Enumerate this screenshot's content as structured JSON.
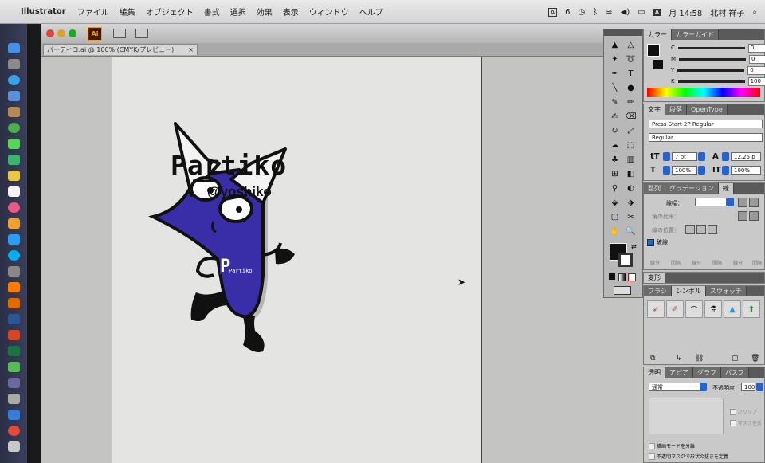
{
  "menubar": {
    "app_name": "Illustrator",
    "items": [
      "ファイル",
      "編集",
      "オブジェクト",
      "書式",
      "選択",
      "効果",
      "表示",
      "ウィンドウ",
      "ヘルプ"
    ],
    "status": {
      "input_indicator": "A",
      "badge": "6",
      "clock": "月 14:58",
      "user": "北村 祥子"
    }
  },
  "window": {
    "tab_title": "パーティコ.ai @ 100% (CMYK/プレビュー)",
    "tab_close": "×"
  },
  "artwork": {
    "title": "Partiko",
    "handle": "@yoshiko",
    "shirt_letters": "Partiko",
    "character_color": "#3a2ea8"
  },
  "color_panel": {
    "tabs": [
      "カラー",
      "カラーガイド"
    ],
    "channels": [
      {
        "label": "C",
        "value": "0"
      },
      {
        "label": "M",
        "value": "0"
      },
      {
        "label": "Y",
        "value": "0"
      },
      {
        "label": "K",
        "value": "100"
      }
    ]
  },
  "type_panel": {
    "tabs": [
      "文字",
      "段落",
      "OpenType"
    ],
    "font_family": "Press Start 2P Regular",
    "font_style": "Regular",
    "font_size": "7 pt",
    "leading": "12.25 p",
    "vertical_scale": "100%",
    "horizontal_scale": "100%"
  },
  "stroke_panel": {
    "tabs": [
      "整列",
      "グラデーション",
      "線"
    ],
    "weight_label": "線幅：",
    "cap_label": "角の比率：",
    "align_label": "線の位置：",
    "dashed_label": "破線",
    "small_labels": [
      "線分",
      "間隔",
      "線分",
      "間隔",
      "線分",
      "間隔"
    ]
  },
  "transform_tab": "変形",
  "symbols_panel": {
    "tabs": [
      "ブラシ",
      "シンボル",
      "スウォッチ"
    ],
    "icons": [
      "rocket-icon",
      "brush-icon",
      "arc-icon",
      "bottle-icon",
      "pyramid-icon",
      "arrow-up-icon"
    ]
  },
  "transparency_panel": {
    "tabs": [
      "透明",
      "アピア",
      "グラフ",
      "パスフ"
    ],
    "blend_mode": "通常",
    "opacity_label": "不透明度：",
    "opacity": "100",
    "clip_label": "クリップ",
    "invert_label": "マスクを反",
    "isolate_label": "描画モードを分離",
    "knockout_label": "不透明マスクで形状の抜きを定義"
  }
}
